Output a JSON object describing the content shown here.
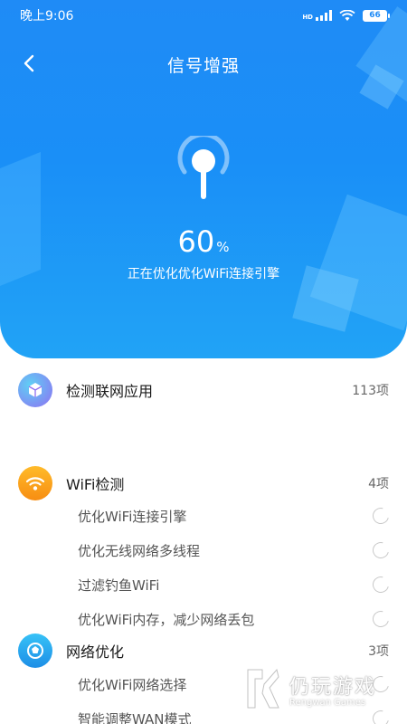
{
  "status_bar": {
    "time": "晚上9:06",
    "battery": "66",
    "network_badge": "HD"
  },
  "header": {
    "title": "信号增强",
    "progress_percent": 60,
    "progress_value": "60",
    "progress_unit": "%",
    "subtitle": "正在优化优化WiFi连接引擎"
  },
  "colors": {
    "header_blue": "#1f8bf6",
    "wifi_orange": "#f9a11b",
    "purple_icon": "#8f6ff2",
    "cyan_icon": "#27aef0"
  },
  "sections": [
    {
      "icon": "cube-icon",
      "title": "检测联网应用",
      "count": "113项",
      "items": []
    },
    {
      "icon": "wifi-icon",
      "title": "WiFi检测",
      "count": "4项",
      "items": [
        "优化WiFi连接引擎",
        "优化无线网络多线程",
        "过滤钓鱼WiFi",
        "优化WiFi内存，减少网络丢包"
      ]
    },
    {
      "icon": "network-optimize-icon",
      "title": "网络优化",
      "count": "3项",
      "items": [
        "优化WiFi网络选择",
        "智能调整WAN模式"
      ]
    }
  ],
  "watermark": {
    "cn": "仍玩游戏",
    "en": "Rengwan Games"
  }
}
